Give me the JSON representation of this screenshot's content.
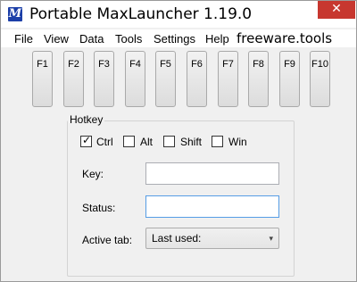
{
  "window": {
    "title": "Portable MaxLauncher 1.19.0",
    "close_glyph": "✕",
    "app_icon_letter": "M",
    "accent": "#1c3fa8",
    "close_color": "#c7372f"
  },
  "menu": {
    "items": [
      "File",
      "View",
      "Data",
      "Tools",
      "Settings",
      "Help"
    ],
    "brand": "freeware.tools"
  },
  "fkeys": [
    "F1",
    "F2",
    "F3",
    "F4",
    "F5",
    "F6",
    "F7",
    "F8",
    "F9",
    "F10"
  ],
  "hotkey": {
    "group_label": "Hotkey",
    "modifiers": [
      {
        "label": "Ctrl",
        "checked": true
      },
      {
        "label": "Alt",
        "checked": false
      },
      {
        "label": "Shift",
        "checked": false
      },
      {
        "label": "Win",
        "checked": false
      }
    ],
    "key_label": "Key:",
    "key_value": "",
    "status_label": "Status:",
    "status_value": "",
    "active_tab_label": "Active tab:",
    "active_tab_value": "Last used:"
  }
}
